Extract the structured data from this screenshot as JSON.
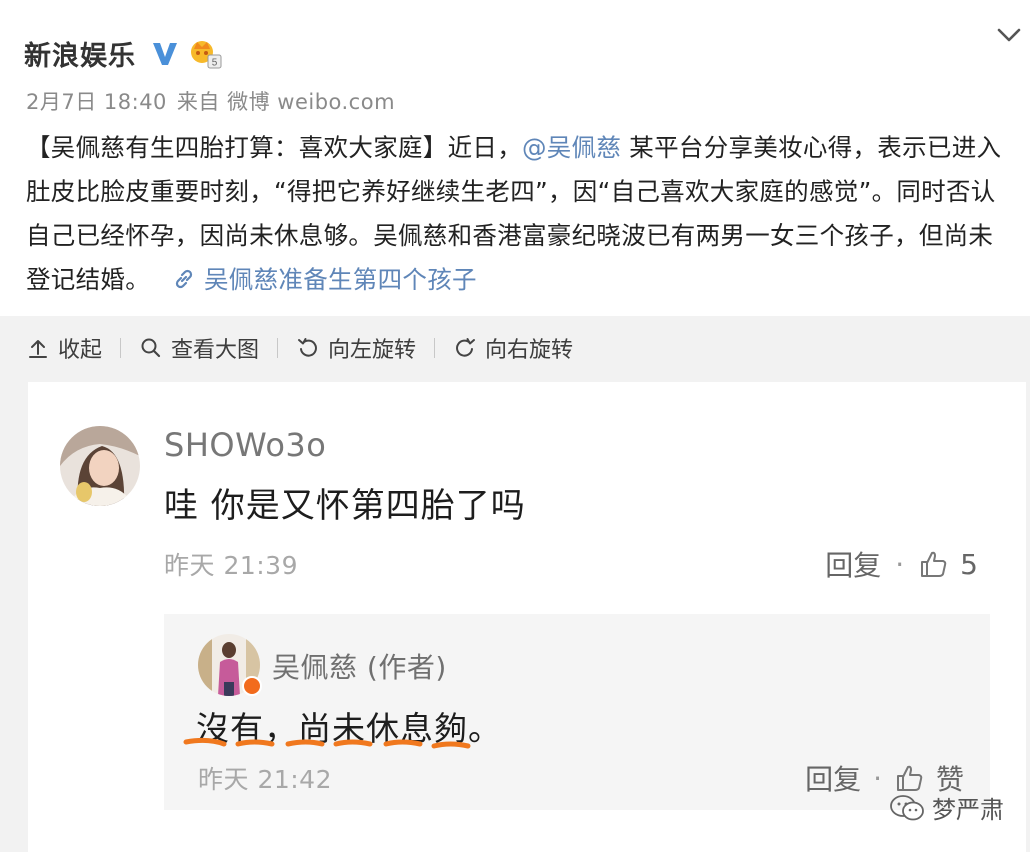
{
  "post": {
    "author": "新浪娱乐",
    "crown_badge": "5",
    "time": "2月7日 18:40",
    "source": "来自 微博 weibo.com",
    "text_part1": "【吴佩慈有生四胎打算：喜欢大家庭】近日，",
    "mention": "@吴佩慈",
    "text_part2": " 某平台分享美妆心得，表示已进入肚皮比脸皮重要时刻，“得把它养好继续生老四”，因“自己喜欢大家庭的感觉”。同时否认自己已经怀孕，因尚未休息够。吴佩慈和香港富豪纪晓波已有两男一女三个孩子，但尚未登记结婚。",
    "link_text": "吴佩慈准备生第四个孩子"
  },
  "toolbar": {
    "collapse": "收起",
    "view_large": "查看大图",
    "rotate_left": "向左旋转",
    "rotate_right": "向右旋转"
  },
  "comment": {
    "username": "SHOWo3o",
    "text": "哇 你是又怀第四胎了吗",
    "time": "昨天 21:39",
    "reply_label": "回复",
    "likes": "5"
  },
  "reply": {
    "username": "吴佩慈 (作者)",
    "text": "沒有，尚未休息夠。",
    "time": "昨天 21:42",
    "reply_label": "回复",
    "like_label": "赞"
  },
  "watermark": {
    "text": "梦严肃"
  },
  "icons": {
    "verified": "verified-v-icon",
    "crown": "crown-level-icon",
    "chevron": "chevron-down-icon",
    "link": "link-icon",
    "collapse": "arrow-up-icon",
    "zoom": "search-icon",
    "rotate_left": "rotate-left-icon",
    "rotate_right": "rotate-right-icon",
    "thumb": "thumbs-up-icon",
    "wechat": "wechat-icon"
  },
  "colors": {
    "link_blue": "#5f86b8",
    "verified_blue": "#4a90d9",
    "crown_gold": "#f5b11c",
    "underline_orange": "#f0781e",
    "media_bg": "#f2f2f2"
  }
}
